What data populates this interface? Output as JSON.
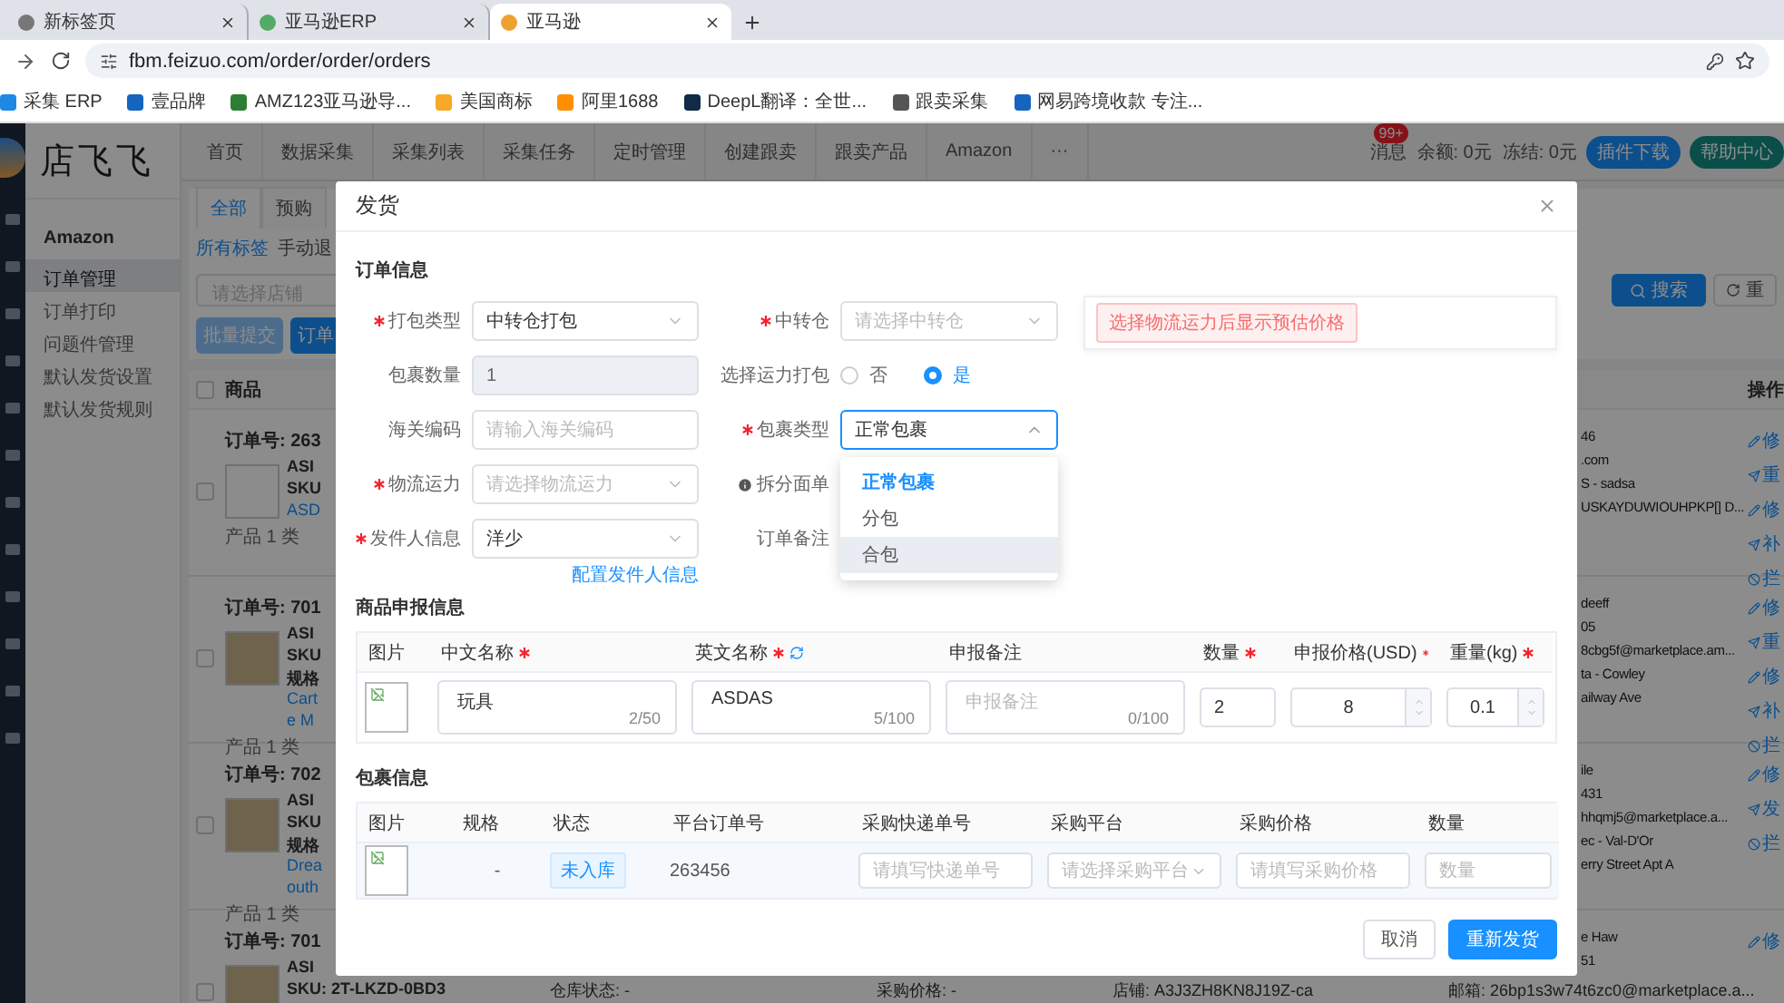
{
  "browser": {
    "tabs": [
      {
        "title": "新标签页",
        "selected": false
      },
      {
        "title": "亚马逊ERP",
        "selected": false
      },
      {
        "title": "亚马逊",
        "selected": true
      }
    ],
    "url": "fbm.feizuo.com/order/order/orders",
    "bookmarks": [
      "采集 ERP",
      "壹品牌",
      "AMZ123亚马逊导...",
      "美国商标",
      "阿里1688",
      "DeepL翻译：全世...",
      "跟卖采集",
      "网易跨境收款 专注..."
    ]
  },
  "app": {
    "logo": "店飞飞",
    "nav": [
      "首页",
      "数据采集",
      "采集列表",
      "采集任务",
      "定时管理",
      "创建跟卖",
      "跟卖产品",
      "Amazon",
      "···"
    ],
    "header": {
      "messages": "消息",
      "badge": "99+",
      "balance": "余额: 0元",
      "frozen": "冻结: 0元",
      "buttons": [
        {
          "label": "插件下载",
          "kind": "primary"
        },
        {
          "label": "帮助中心",
          "kind": "teal"
        }
      ]
    },
    "sidebar": {
      "title": "Amazon",
      "items": [
        {
          "label": "订单管理",
          "selected": true
        },
        {
          "label": "订单打印",
          "selected": false
        },
        {
          "label": "问题件管理",
          "selected": false
        },
        {
          "label": "默认发货设置",
          "selected": false
        },
        {
          "label": "默认发货规则",
          "selected": false
        }
      ]
    },
    "main": {
      "tabs": [
        {
          "label": "全部",
          "selected": true
        },
        {
          "label": "预购",
          "selected": false
        }
      ],
      "filters": [
        {
          "label": "所有标签",
          "selected": true
        },
        {
          "label": "手动退",
          "selected": false
        }
      ],
      "store_select": {
        "placeholder": "请选择店铺"
      },
      "actions": [
        {
          "label": "批量提交",
          "disabled": true
        },
        {
          "label": "订单",
          "disabled": false
        }
      ],
      "search_button": "搜索",
      "reset_button": "重",
      "header_checked": false,
      "columns": [
        "商品",
        "操作"
      ],
      "orders": [
        {
          "checked": false,
          "order_no": "订单号: 263",
          "thumb": {
            "kind": "broken"
          },
          "lines": [
            {
              "text": "ASI",
              "kind": "label"
            },
            {
              "text": "SKU",
              "kind": "label"
            },
            {
              "text": "ASD",
              "kind": "link"
            }
          ],
          "summary": "产品 1 类",
          "contact": [
            "46",
            ".com",
            "S - sadsa",
            "USKAYDUWIOUHPKP[] D..."
          ],
          "actions": [
            {
              "label": "修",
              "kind": "edit"
            },
            {
              "label": "重",
              "kind": "send"
            },
            {
              "label": "修",
              "kind": "edit"
            },
            {
              "label": "补",
              "kind": "send"
            },
            {
              "label": "拦",
              "kind": "block"
            }
          ]
        },
        {
          "checked": false,
          "order_no": "订单号: 701",
          "thumb": {
            "kind": "photo"
          },
          "lines": [
            {
              "text": "ASI",
              "kind": "label"
            },
            {
              "text": "SKU",
              "kind": "label"
            },
            {
              "text": "规格",
              "kind": "label"
            },
            {
              "text": "Cart",
              "kind": "link"
            },
            {
              "text": "e M",
              "kind": "link"
            }
          ],
          "summary": "产品 1 类",
          "contact": [
            "deeff",
            "05",
            "8cbg5f@marketplace.am...",
            "ta - Cowley",
            "ailway Ave"
          ],
          "actions": [
            {
              "label": "修",
              "kind": "edit"
            },
            {
              "label": "重",
              "kind": "send"
            },
            {
              "label": "修",
              "kind": "edit"
            },
            {
              "label": "补",
              "kind": "send"
            },
            {
              "label": "拦",
              "kind": "block"
            }
          ]
        },
        {
          "checked": false,
          "order_no": "订单号: 702",
          "thumb": {
            "kind": "photo"
          },
          "lines": [
            {
              "text": "ASI",
              "kind": "label"
            },
            {
              "text": "SKU",
              "kind": "label"
            },
            {
              "text": "规格",
              "kind": "label"
            },
            {
              "text": "Drea",
              "kind": "link"
            },
            {
              "text": "outh",
              "kind": "link"
            }
          ],
          "summary": "产品 1 类",
          "contact": [
            "ile",
            "431",
            "hhqmj5@marketplace.a...",
            "ec - Val-D'Or",
            "erry Street Apt A"
          ],
          "actions": [
            {
              "label": "修",
              "kind": "edit"
            },
            {
              "label": "发",
              "kind": "send"
            },
            {
              "label": "拦",
              "kind": "block"
            }
          ]
        },
        {
          "checked": false,
          "order_no": "订单号: 701",
          "thumb": {
            "kind": "photo"
          },
          "lines": [
            {
              "text": "ASI",
              "kind": "label"
            },
            {
              "text": "SKU: 2T-LKZD-0BD3",
              "kind": "label"
            }
          ],
          "details": [
            "仓库状态: -",
            "采购价格: -",
            "店铺: A3J3ZH8KN8J19Z-ca",
            "邮箱: 26bp1s3w74t6zc0@marketplace.a..."
          ],
          "contact": [
            "e Haw",
            "51"
          ],
          "actions": [
            {
              "label": "修",
              "kind": "edit"
            }
          ]
        }
      ]
    }
  },
  "dialog": {
    "title": "发货",
    "order_info": {
      "title": "订单信息",
      "rows": [
        [
          {
            "label": "打包类型",
            "required": true,
            "kind": "select",
            "value": "中转仓打包"
          },
          {
            "label": "中转仓",
            "required": true,
            "kind": "select",
            "placeholder": "请选择中转仓"
          }
        ],
        [
          {
            "label": "包裹数量",
            "required": false,
            "kind": "input",
            "value": "1",
            "disabled": true
          },
          {
            "label": "选择运力打包",
            "required": false,
            "kind": "radio",
            "options": [
              {
                "label": "否",
                "selected": false
              },
              {
                "label": "是",
                "selected": true
              }
            ]
          }
        ],
        [
          {
            "label": "海关编码",
            "required": false,
            "kind": "input",
            "placeholder": "请输入海关编码",
            "disabled": false
          },
          {
            "label": "包裹类型",
            "required": true,
            "kind": "select",
            "value": "正常包裹",
            "expanded": true
          }
        ],
        [
          {
            "label": "物流运力",
            "required": true,
            "kind": "select",
            "placeholder": "请选择物流运力"
          },
          {
            "label": "拆分面单",
            "required": false,
            "kind": "label",
            "info": true
          }
        ],
        [
          {
            "label": "发件人信息",
            "required": true,
            "kind": "select",
            "value": "洋少",
            "link": "配置发件人信息"
          },
          {
            "label": "订单备注",
            "required": false,
            "kind": "label",
            "info": false
          }
        ]
      ],
      "dropdown_options": [
        {
          "label": "正常包裹",
          "selected": true,
          "hovered": false
        },
        {
          "label": "分包",
          "selected": false,
          "hovered": false
        },
        {
          "label": "合包",
          "selected": false,
          "hovered": true
        }
      ],
      "notice": "选择物流运力后显示预估价格"
    },
    "declaration": {
      "title": "商品申报信息",
      "columns": [
        {
          "label": "图片",
          "required": false,
          "refresh": false
        },
        {
          "label": "中文名称",
          "required": true,
          "refresh": false
        },
        {
          "label": "英文名称",
          "required": true,
          "refresh": true
        },
        {
          "label": "申报备注",
          "required": false,
          "refresh": false
        },
        {
          "label": "数量",
          "required": true,
          "refresh": false
        },
        {
          "label": "申报价格(USD)",
          "required": true,
          "refresh": false
        },
        {
          "label": "重量(kg)",
          "required": true,
          "refresh": false
        }
      ],
      "row": {
        "cn_name": {
          "value": "玩具",
          "count": "2/50"
        },
        "en_name": {
          "value": "ASDAS",
          "count": "5/100"
        },
        "note": {
          "placeholder": "申报备注",
          "count": "0/100"
        },
        "quantity": "2",
        "price": "8",
        "weight": "0.1"
      }
    },
    "package": {
      "title": "包裹信息",
      "columns": [
        "图片",
        "规格",
        "状态",
        "平台订单号",
        "采购快递单号",
        "采购平台",
        "采购价格",
        "数量"
      ],
      "row": {
        "spec": "-",
        "status": "未入库",
        "platform_order": "263456",
        "tracking": {
          "placeholder": "请填写快递单号"
        },
        "platform": {
          "placeholder": "请选择采购平台"
        },
        "price": {
          "placeholder": "请填写采购价格"
        },
        "quantity": {
          "placeholder": "数量"
        }
      }
    },
    "footer": {
      "cancel": "取消",
      "submit": "重新发货"
    }
  }
}
